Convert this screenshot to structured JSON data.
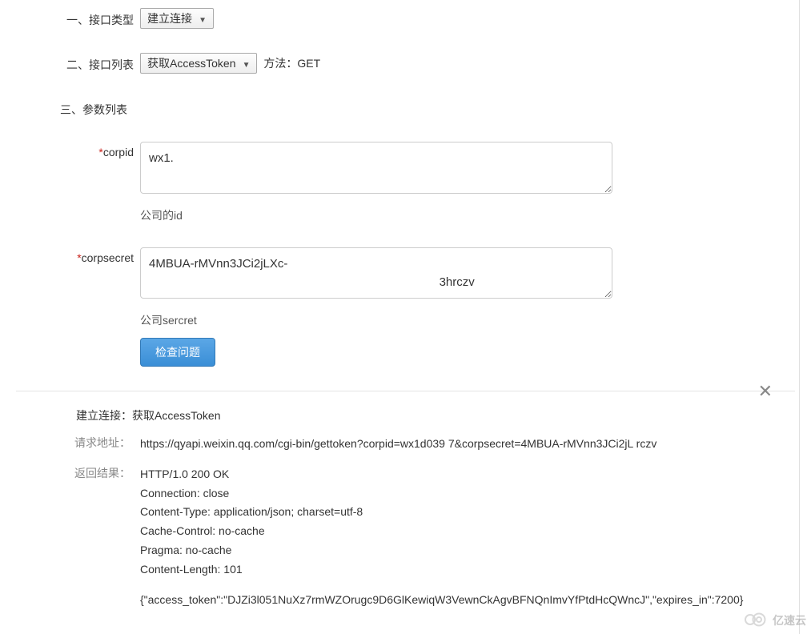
{
  "form": {
    "row1": {
      "label": "一、接口类型",
      "select": "建立连接"
    },
    "row2": {
      "label": "二、接口列表",
      "select": "获取AccessToken",
      "method_label": "方法：",
      "method_value": "GET"
    },
    "row3": {
      "label": "三、参数列表"
    },
    "corpid": {
      "label": "corpid",
      "value": "wx1.",
      "help": "公司的id"
    },
    "corpsecret": {
      "label": "corpsecret",
      "value": "4MBUA-rMVnn3JCi2jLXc-\n                                                                                       3hrczv",
      "help": "公司sercret"
    },
    "button": {
      "label": "检查问题"
    }
  },
  "result": {
    "heading": "建立连接：获取AccessToken",
    "url_label": "请求地址：",
    "url_value": "https://qyapi.weixin.qq.com/cgi-bin/gettoken?corpid=wx1d039                     7&corpsecret=4MBUA-rMVnn3JCi2jL                                                                                        rczv",
    "resp_label": "返回结果：",
    "resp_headers": "HTTP/1.0 200 OK\nConnection: close\nContent-Type: application/json; charset=utf-8\nCache-Control: no-cache\nPragma: no-cache\nContent-Length: 101",
    "resp_body": "{\"access_token\":\"DJZi3l051NuXz7rmWZOrugc9D6GlKewiqW3VewnCkAgvBFNQnImvYfPtdHcQWncJ\",\"expires_in\":7200}"
  },
  "watermark": {
    "text": "亿速云"
  }
}
